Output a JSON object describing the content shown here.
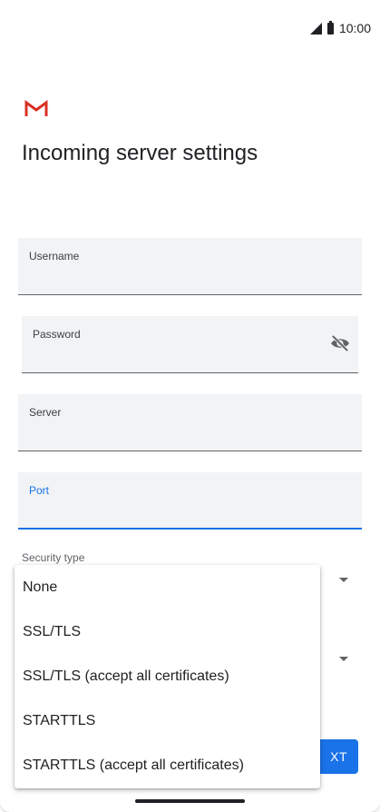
{
  "status": {
    "time": "10:00"
  },
  "page": {
    "title": "Incoming server settings"
  },
  "fields": {
    "username": {
      "label": "Username"
    },
    "password": {
      "label": "Password"
    },
    "server": {
      "label": "Server"
    },
    "port": {
      "label": "Port"
    }
  },
  "security": {
    "label": "Security type",
    "options": [
      "None",
      "SSL/TLS",
      "SSL/TLS (accept all certificates)",
      "STARTTLS",
      "STARTTLS (accept all certificates)"
    ]
  },
  "buttons": {
    "next_visible_text": "XT"
  },
  "colors": {
    "accent": "#1a73e8",
    "gmail_red": "#d93025",
    "field_bg": "#f1f3f4"
  },
  "icons": {
    "logo": "gmail-logo",
    "visibility": "visibility-off-icon",
    "dropdown": "arrow-drop-down-icon"
  }
}
